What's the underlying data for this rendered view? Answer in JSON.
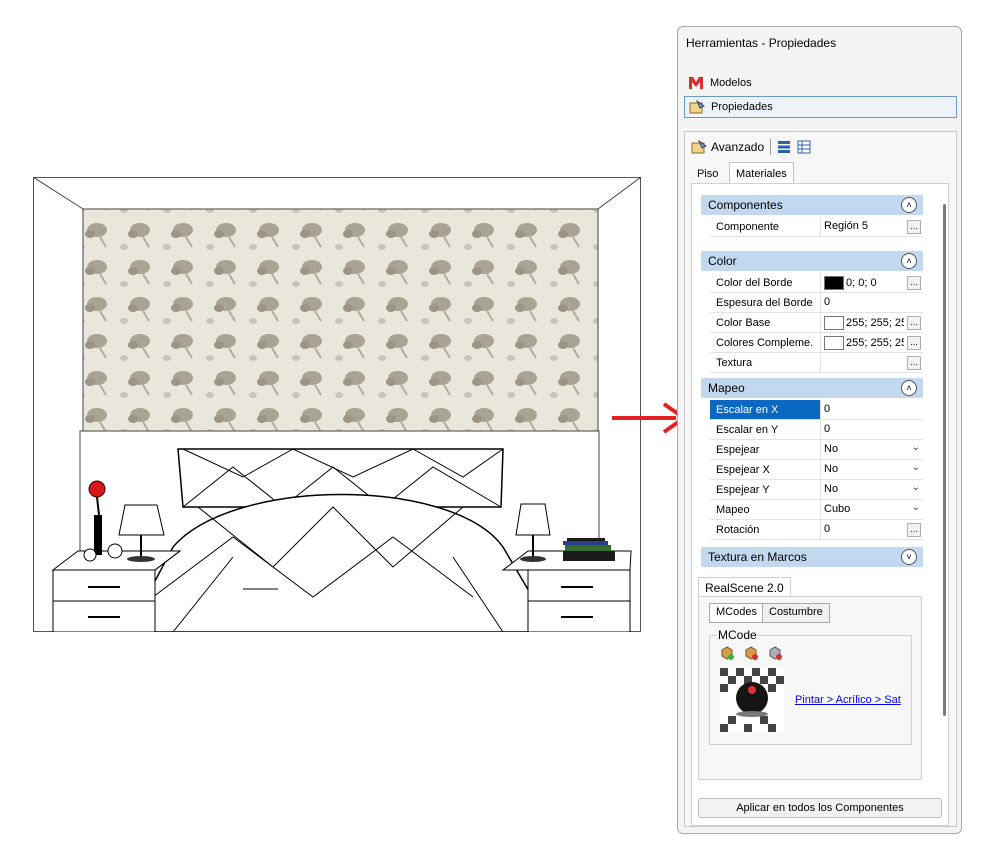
{
  "panel": {
    "title": "Herramientas - Propiedades",
    "nav": [
      {
        "label": "Modelos",
        "icon": "models-icon"
      },
      {
        "label": "Propiedades",
        "icon": "properties-icon"
      }
    ],
    "toolbar": {
      "avanzado_label": "Avanzado"
    },
    "tabs": [
      {
        "label": "Piso"
      },
      {
        "label": "Materiales"
      }
    ],
    "sections": {
      "componentes": {
        "title": "Componentes",
        "rows": [
          {
            "key": "Componente",
            "value": "Región 5"
          }
        ]
      },
      "color": {
        "title": "Color",
        "rows": [
          {
            "key": "Color del Borde",
            "value": "0; 0; 0",
            "swatch": "#000000"
          },
          {
            "key": "Espesura del Borde",
            "value": "0"
          },
          {
            "key": "Color Base",
            "value": "255; 255; 25",
            "swatch": "#ffffff"
          },
          {
            "key": "Colores Compleme...",
            "value": "255; 255; 25",
            "swatch": "#ffffff"
          },
          {
            "key": "Textura",
            "value": ""
          }
        ]
      },
      "mapeo": {
        "title": "Mapeo",
        "rows": [
          {
            "key": "Escalar en X",
            "value": "0"
          },
          {
            "key": "Escalar en Y",
            "value": "0"
          },
          {
            "key": "Espejear",
            "value": "No"
          },
          {
            "key": "Espejear X",
            "value": "No"
          },
          {
            "key": "Espejear Y",
            "value": "No"
          },
          {
            "key": "Mapeo",
            "value": "Cubo"
          },
          {
            "key": "Rotación",
            "value": "0"
          }
        ]
      },
      "textura_marcos": {
        "title": "Textura en Marcos"
      }
    },
    "realscene": {
      "tab_label": "RealScene 2.0",
      "subtabs": [
        {
          "label": "MCodes"
        },
        {
          "label": "Costumbre"
        }
      ],
      "group_label": "MCode",
      "link_text": "Pintar > Acrílico > Sat"
    },
    "apply_button": "Aplicar en todos los Componentes"
  },
  "colors": {
    "selection": "#0a67c2",
    "section_header": "#c2d8ef",
    "arrow": "#e52020"
  }
}
